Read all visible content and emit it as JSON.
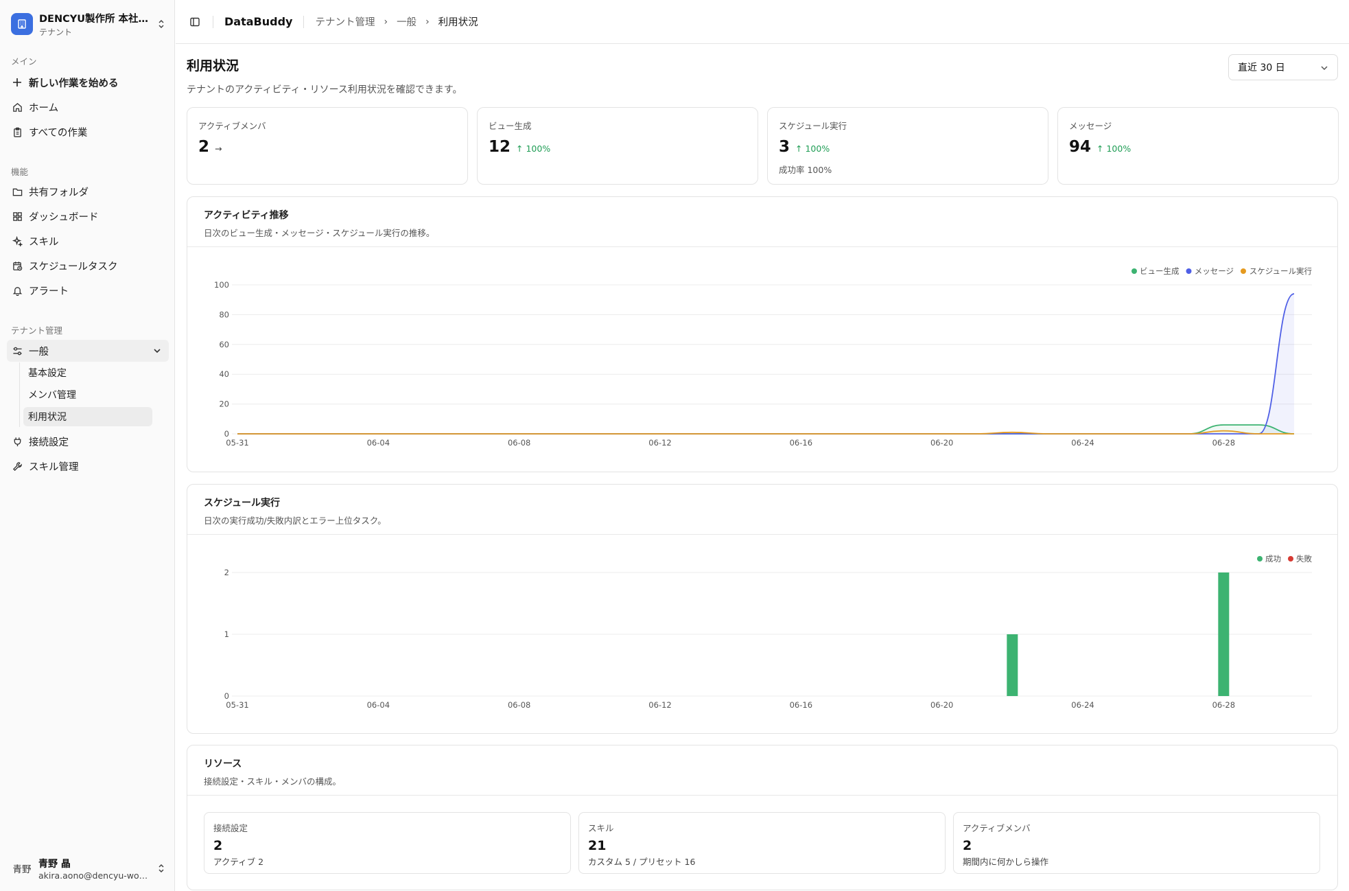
{
  "sidebar": {
    "tenant": {
      "name": "DENCYU製作所 本社工場",
      "sub": "テナント"
    },
    "groups": {
      "main": "メイン",
      "features": "機能",
      "tenant_admin": "テナント管理"
    },
    "items": {
      "new_work": "新しい作業を始める",
      "home": "ホーム",
      "all_work": "すべての作業",
      "shared_folder": "共有フォルダ",
      "dashboard": "ダッシュボード",
      "skills": "スキル",
      "scheduled_tasks": "スケジュールタスク",
      "alerts": "アラート",
      "general": "一般",
      "basic_settings": "基本設定",
      "member_mgmt": "メンバ管理",
      "usage": "利用状況",
      "connections": "接続設定",
      "skill_mgmt": "スキル管理"
    },
    "user": {
      "avatar": "青野",
      "name": "青野 晶",
      "email": "akira.aono@dencyu-works.co.jp"
    }
  },
  "header": {
    "app_name": "DataBuddy",
    "breadcrumb": [
      "テナント管理",
      "一般",
      "利用状況"
    ]
  },
  "page": {
    "title": "利用状況",
    "description": "テナントのアクティビティ・リソース利用状況を確認できます。",
    "range": "直近 30 日"
  },
  "stats": [
    {
      "label": "アクティブメンバ",
      "value": "2",
      "delta": "→",
      "extra": ""
    },
    {
      "label": "ビュー生成",
      "value": "12",
      "delta": "↑ 100%",
      "extra": ""
    },
    {
      "label": "スケジュール実行",
      "value": "3",
      "delta": "↑ 100%",
      "extra": "成功率 100%"
    },
    {
      "label": "メッセージ",
      "value": "94",
      "delta": "↑ 100%",
      "extra": ""
    }
  ],
  "activity_card": {
    "title": "アクティビティ推移",
    "desc": "日次のビュー生成・メッセージ・スケジュール実行の推移。"
  },
  "schedule_card": {
    "title": "スケジュール実行",
    "desc": "日次の実行成功/失敗内訳とエラー上位タスク。"
  },
  "resource_card": {
    "title": "リソース",
    "desc": "接続設定・スキル・メンバの構成。",
    "items": [
      {
        "label": "接続設定",
        "value": "2",
        "sub": "アクティブ 2"
      },
      {
        "label": "スキル",
        "value": "21",
        "sub": "カスタム 5 / プリセット 16"
      },
      {
        "label": "アクティブメンバ",
        "value": "2",
        "sub": "期間内に何かしら操作"
      }
    ]
  },
  "colors": {
    "view": "#3cb371",
    "message": "#4f5fe6",
    "schedule": "#e59a1f",
    "success": "#3cb371",
    "fail": "#d63a33",
    "brand": "#3b6fe0"
  },
  "chart_data": [
    {
      "type": "area",
      "ylim": [
        0,
        100
      ],
      "yticks": [
        0,
        20,
        40,
        60,
        80,
        100
      ],
      "xticks": [
        "05-31",
        "06-04",
        "06-08",
        "06-12",
        "06-16",
        "06-20",
        "06-24",
        "06-28"
      ],
      "x": [
        "05-31",
        "06-01",
        "06-02",
        "06-03",
        "06-04",
        "06-05",
        "06-06",
        "06-07",
        "06-08",
        "06-09",
        "06-10",
        "06-11",
        "06-12",
        "06-13",
        "06-14",
        "06-15",
        "06-16",
        "06-17",
        "06-18",
        "06-19",
        "06-20",
        "06-21",
        "06-22",
        "06-23",
        "06-24",
        "06-25",
        "06-26",
        "06-27",
        "06-28",
        "06-29",
        "06-30"
      ],
      "legend": "top-right",
      "series": [
        {
          "name": "ビュー生成",
          "color": "#3cb371",
          "values": [
            0,
            0,
            0,
            0,
            0,
            0,
            0,
            0,
            0,
            0,
            0,
            0,
            0,
            0,
            0,
            0,
            0,
            0,
            0,
            0,
            0,
            0,
            0,
            0,
            0,
            0,
            0,
            0,
            6,
            6,
            0
          ]
        },
        {
          "name": "メッセージ",
          "color": "#4f5fe6",
          "values": [
            0,
            0,
            0,
            0,
            0,
            0,
            0,
            0,
            0,
            0,
            0,
            0,
            0,
            0,
            0,
            0,
            0,
            0,
            0,
            0,
            0,
            0,
            0,
            0,
            0,
            0,
            0,
            0,
            0,
            0,
            94
          ]
        },
        {
          "name": "スケジュール実行",
          "color": "#e59a1f",
          "values": [
            0,
            0,
            0,
            0,
            0,
            0,
            0,
            0,
            0,
            0,
            0,
            0,
            0,
            0,
            0,
            0,
            0,
            0,
            0,
            0,
            0,
            0,
            1,
            0,
            0,
            0,
            0,
            0,
            2,
            0,
            0
          ]
        }
      ]
    },
    {
      "type": "bar",
      "ylim": [
        0,
        2
      ],
      "yticks": [
        0,
        1,
        2
      ],
      "xticks": [
        "05-31",
        "06-04",
        "06-08",
        "06-12",
        "06-16",
        "06-20",
        "06-24",
        "06-28"
      ],
      "x": [
        "05-31",
        "06-01",
        "06-02",
        "06-03",
        "06-04",
        "06-05",
        "06-06",
        "06-07",
        "06-08",
        "06-09",
        "06-10",
        "06-11",
        "06-12",
        "06-13",
        "06-14",
        "06-15",
        "06-16",
        "06-17",
        "06-18",
        "06-19",
        "06-20",
        "06-21",
        "06-22",
        "06-23",
        "06-24",
        "06-25",
        "06-26",
        "06-27",
        "06-28",
        "06-29",
        "06-30"
      ],
      "legend": "top-right",
      "series": [
        {
          "name": "成功",
          "color": "#3cb371",
          "values": [
            0,
            0,
            0,
            0,
            0,
            0,
            0,
            0,
            0,
            0,
            0,
            0,
            0,
            0,
            0,
            0,
            0,
            0,
            0,
            0,
            0,
            0,
            1,
            0,
            0,
            0,
            0,
            0,
            2,
            0,
            0
          ]
        },
        {
          "name": "失敗",
          "color": "#d63a33",
          "values": [
            0,
            0,
            0,
            0,
            0,
            0,
            0,
            0,
            0,
            0,
            0,
            0,
            0,
            0,
            0,
            0,
            0,
            0,
            0,
            0,
            0,
            0,
            0,
            0,
            0,
            0,
            0,
            0,
            0,
            0,
            0
          ]
        }
      ]
    }
  ]
}
